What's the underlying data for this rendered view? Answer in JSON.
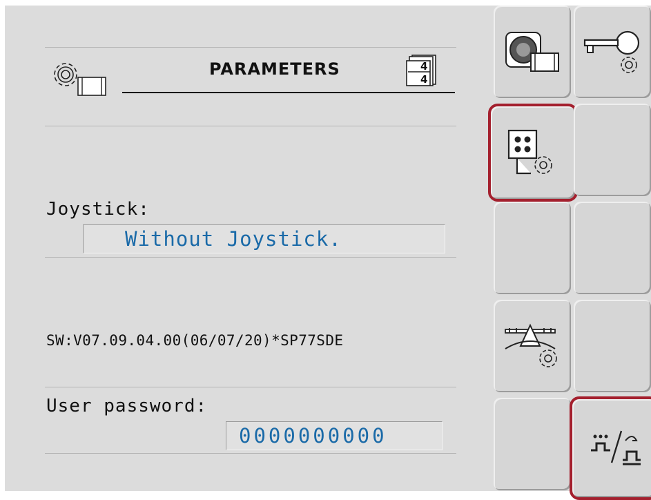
{
  "header": {
    "title": "PARAMETERS",
    "page_indicator": "4/4",
    "page_current": "4",
    "page_total": "4"
  },
  "joystick": {
    "label": "Joystick:",
    "value": "Without Joystick."
  },
  "software_version": "SW:V07.09.04.00(06/07/20)*SP77SDE",
  "password": {
    "label": "User password:",
    "value": "0000000000"
  },
  "softkeys": [
    {
      "icon": "camera-settings-icon",
      "selected": false
    },
    {
      "icon": "key-settings-icon",
      "selected": false
    },
    {
      "icon": "joystick-settings-icon",
      "selected": true
    },
    {
      "icon": "empty",
      "selected": false
    },
    {
      "icon": "empty",
      "selected": false
    },
    {
      "icon": "empty",
      "selected": false
    },
    {
      "icon": "boom-settings-icon",
      "selected": false
    },
    {
      "icon": "empty",
      "selected": false
    },
    {
      "icon": "empty",
      "selected": false
    },
    {
      "icon": "mode-toggle-icon",
      "selected": true
    }
  ],
  "colors": {
    "screen_bg": "#dcdcdc",
    "value_text": "#1a6aa8",
    "selection_border": "#a4202e"
  }
}
